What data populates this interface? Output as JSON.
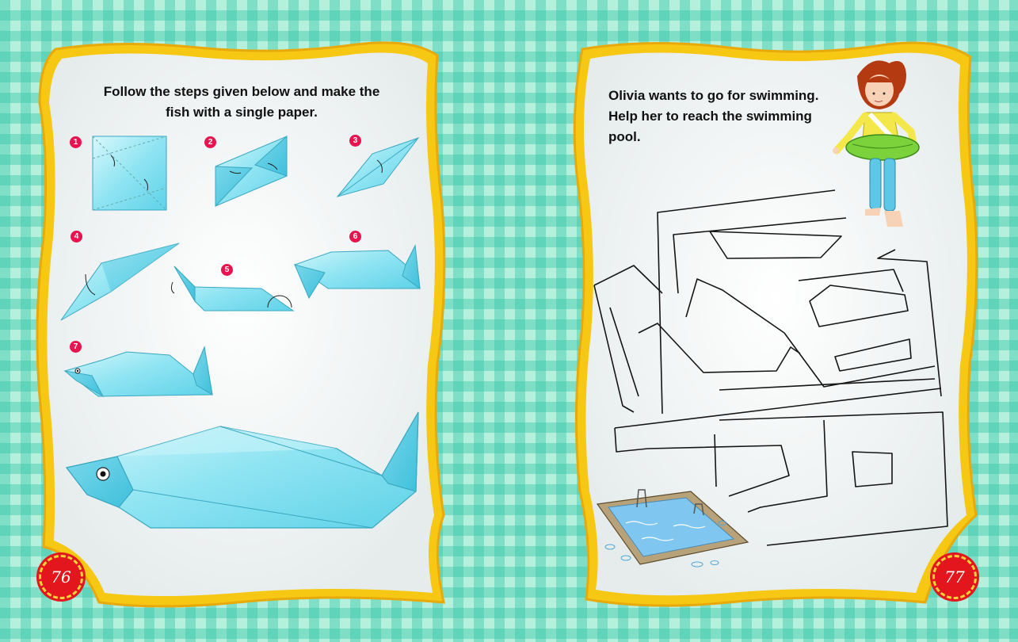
{
  "left_page": {
    "instructions": "Follow the steps given below and make the fish with a single paper.",
    "steps": [
      "1",
      "2",
      "3",
      "4",
      "5",
      "6",
      "7"
    ],
    "page_number": "76"
  },
  "right_page": {
    "instructions": "Olivia wants to go for swimming. Help her to reach the swimming pool.",
    "page_number": "77"
  },
  "colors": {
    "background": "#b4f0dc",
    "frame": "#f6c814",
    "paper": "#8fe4f2",
    "badge": "#e8134f",
    "page_number": "#e2161c"
  }
}
